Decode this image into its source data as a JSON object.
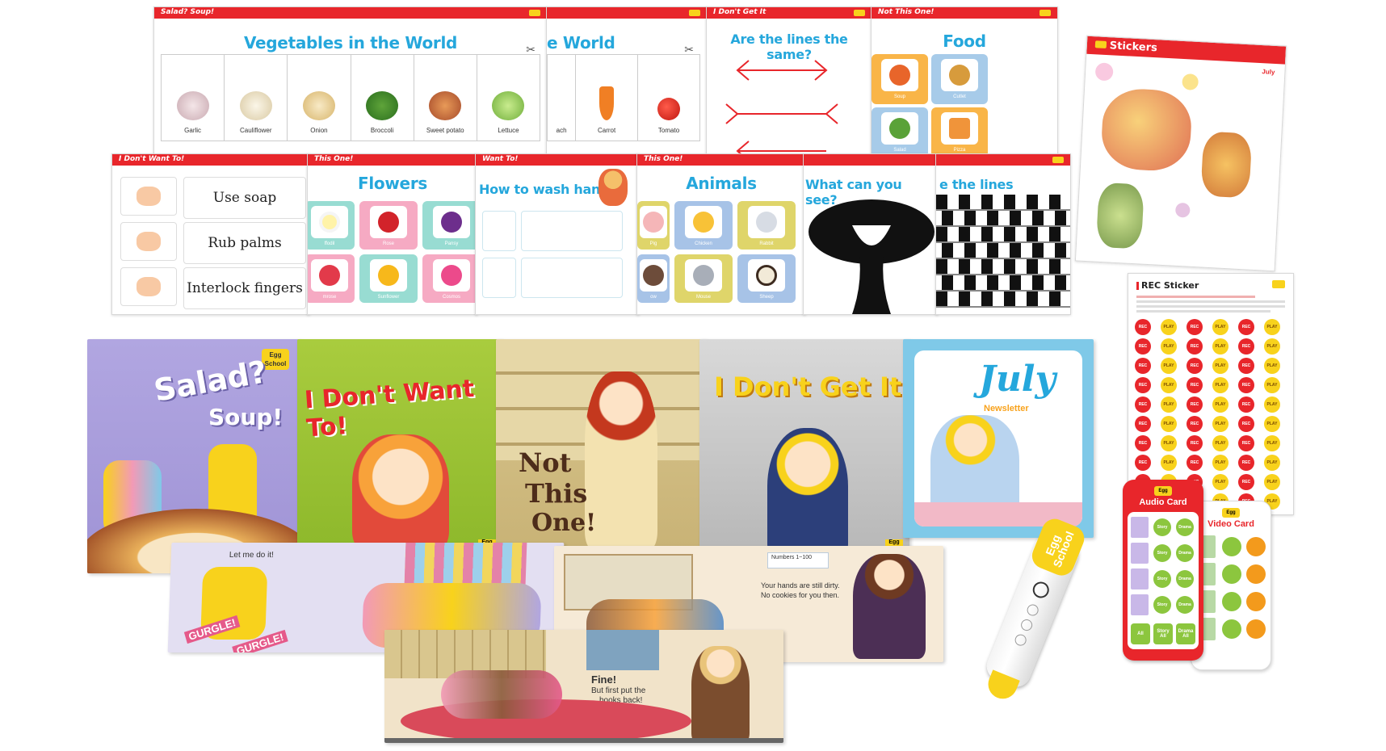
{
  "veg_sheet": {
    "header": "Salad? Soup!",
    "title": "Vegetables in the World",
    "items": [
      "Garlic",
      "Cauliflower",
      "Onion",
      "Broccoli",
      "Sweet potato",
      "Lettuce"
    ]
  },
  "veg_sheet2": {
    "title": "e World",
    "items": [
      "ach",
      "Carrot",
      "Tomato"
    ]
  },
  "lines_sheet": {
    "header": "I Don't Get It",
    "title": "Are the lines the same?"
  },
  "food_sheet": {
    "header": "Not This One!",
    "title": "Food",
    "items": [
      "Soup",
      "Cutlet",
      "Salad",
      "Pizza"
    ]
  },
  "sticker_sheet": {
    "title": "Stickers",
    "month": "July"
  },
  "wash_sheet": {
    "header": "I Don't Want To!",
    "steps": [
      "Use soap",
      "Rub palms",
      "Interlock fingers"
    ]
  },
  "flowers_sheet": {
    "header": "This One!",
    "title": "Flowers",
    "items": [
      "ffodil",
      "Rose",
      "Pansy",
      "mrose",
      "Sunflower",
      "Cosmos"
    ]
  },
  "hands_sheet": {
    "header": "Want To!",
    "title": "How to wash hands"
  },
  "animals_sheet": {
    "header": "This One!",
    "title": "Animals",
    "items": [
      "Pig",
      "Chicken",
      "Rabbit",
      "ow",
      "Mouse",
      "Sheep"
    ]
  },
  "see_sheet": {
    "title": "What can you see?"
  },
  "straight_sheet": {
    "title": "e the lines straight?"
  },
  "rec_sheet": {
    "title": "REC Sticker",
    "dot_labels": [
      "REC",
      "PLAY",
      "REC",
      "PLAY",
      "REC",
      "PLAY"
    ]
  },
  "books": {
    "salad": {
      "title1": "Salad?",
      "title2": "Soup!",
      "brand": "Egg School"
    },
    "dont_want": {
      "title": "I Don't Want To!",
      "brand": "Egg"
    },
    "not_this": {
      "title1": "Not",
      "title2": "This",
      "title3": "One!"
    },
    "dont_get": {
      "title": "I Don't Get It",
      "brand": "Egg"
    },
    "newsletter": {
      "title": "July",
      "subtitle": "Newsletter"
    }
  },
  "spreads": {
    "left": {
      "text1": "Let me do it!",
      "text2": "GURGLE!",
      "text3": "GURGLE!"
    },
    "right": {
      "text1": "Numbers 1~100",
      "text2": "Your hands are still dirty.",
      "text3": "No cookies for you then."
    },
    "front": {
      "text1": "Fine!",
      "text2": "But first put the",
      "text3": "books back!"
    }
  },
  "pen": {
    "label1": "Egg",
    "label2": "School"
  },
  "audio_card": {
    "brand": "Egg",
    "title": "Audio Card",
    "btn1": "Story",
    "btn2": "Drama",
    "all1": "All",
    "all2": "Story All",
    "all3": "Drama All"
  },
  "video_card": {
    "brand": "Egg",
    "title": "Video Card"
  },
  "colors": {
    "red": "#e8262b",
    "blue": "#25a7dc",
    "yellow": "#f8d21c",
    "green": "#8cc63e"
  }
}
